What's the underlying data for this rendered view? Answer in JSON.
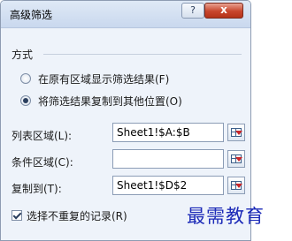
{
  "dialog": {
    "title": "高级筛选",
    "help_glyph": "?",
    "close_glyph": "x"
  },
  "method": {
    "label": "方式",
    "options": [
      {
        "label": "在原有区域显示筛选结果(F)",
        "checked": false
      },
      {
        "label": "将筛选结果复制到其他位置(O)",
        "checked": true
      }
    ]
  },
  "fields": {
    "list_range": {
      "label": "列表区域(L):",
      "value": "Sheet1!$A:$B"
    },
    "criteria_range": {
      "label": "条件区域(C):",
      "value": ""
    },
    "copy_to": {
      "label": "复制到(T):",
      "value": "Sheet1!$D$2"
    }
  },
  "unique_records": {
    "label": "选择不重复的记录(R)",
    "checked": true
  },
  "watermark": {
    "text": "最需教育"
  }
}
